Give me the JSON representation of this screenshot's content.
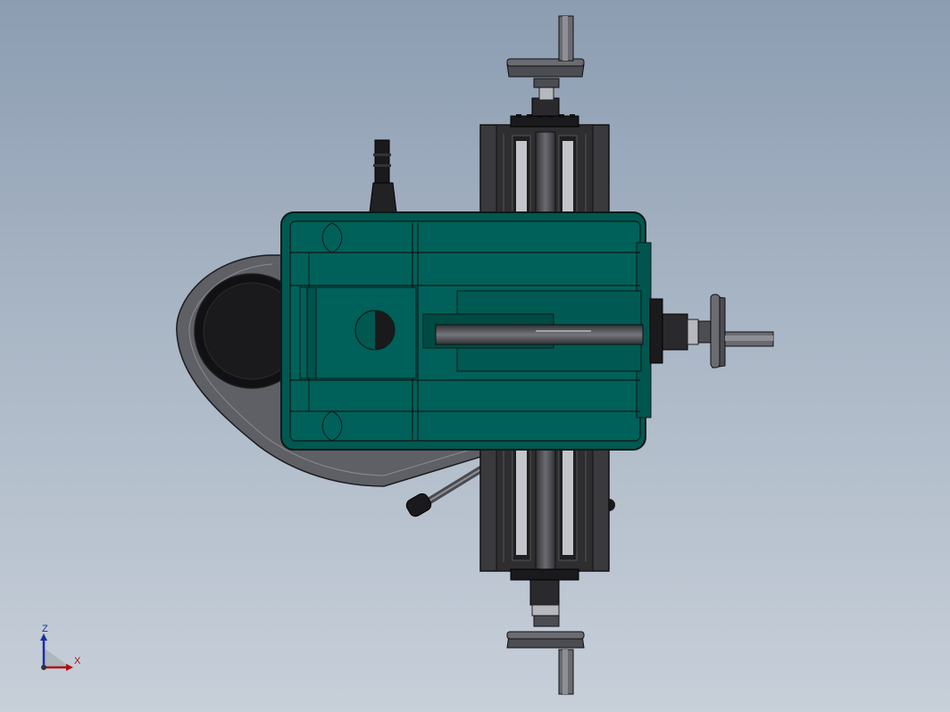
{
  "viewport": {
    "background_top": "#8c9db2",
    "background_bottom": "#c7cfd9"
  },
  "model": {
    "table_color": "#005850",
    "body_color": "#3a3a3c",
    "casting_color": "#5f6066",
    "metal_color": "#b6b8bd",
    "handwheel_color": "#4c4d52"
  },
  "triad": {
    "z_label": "Z",
    "x_label": "X",
    "z_color": "#1a2fa0",
    "x_color": "#b01010"
  }
}
